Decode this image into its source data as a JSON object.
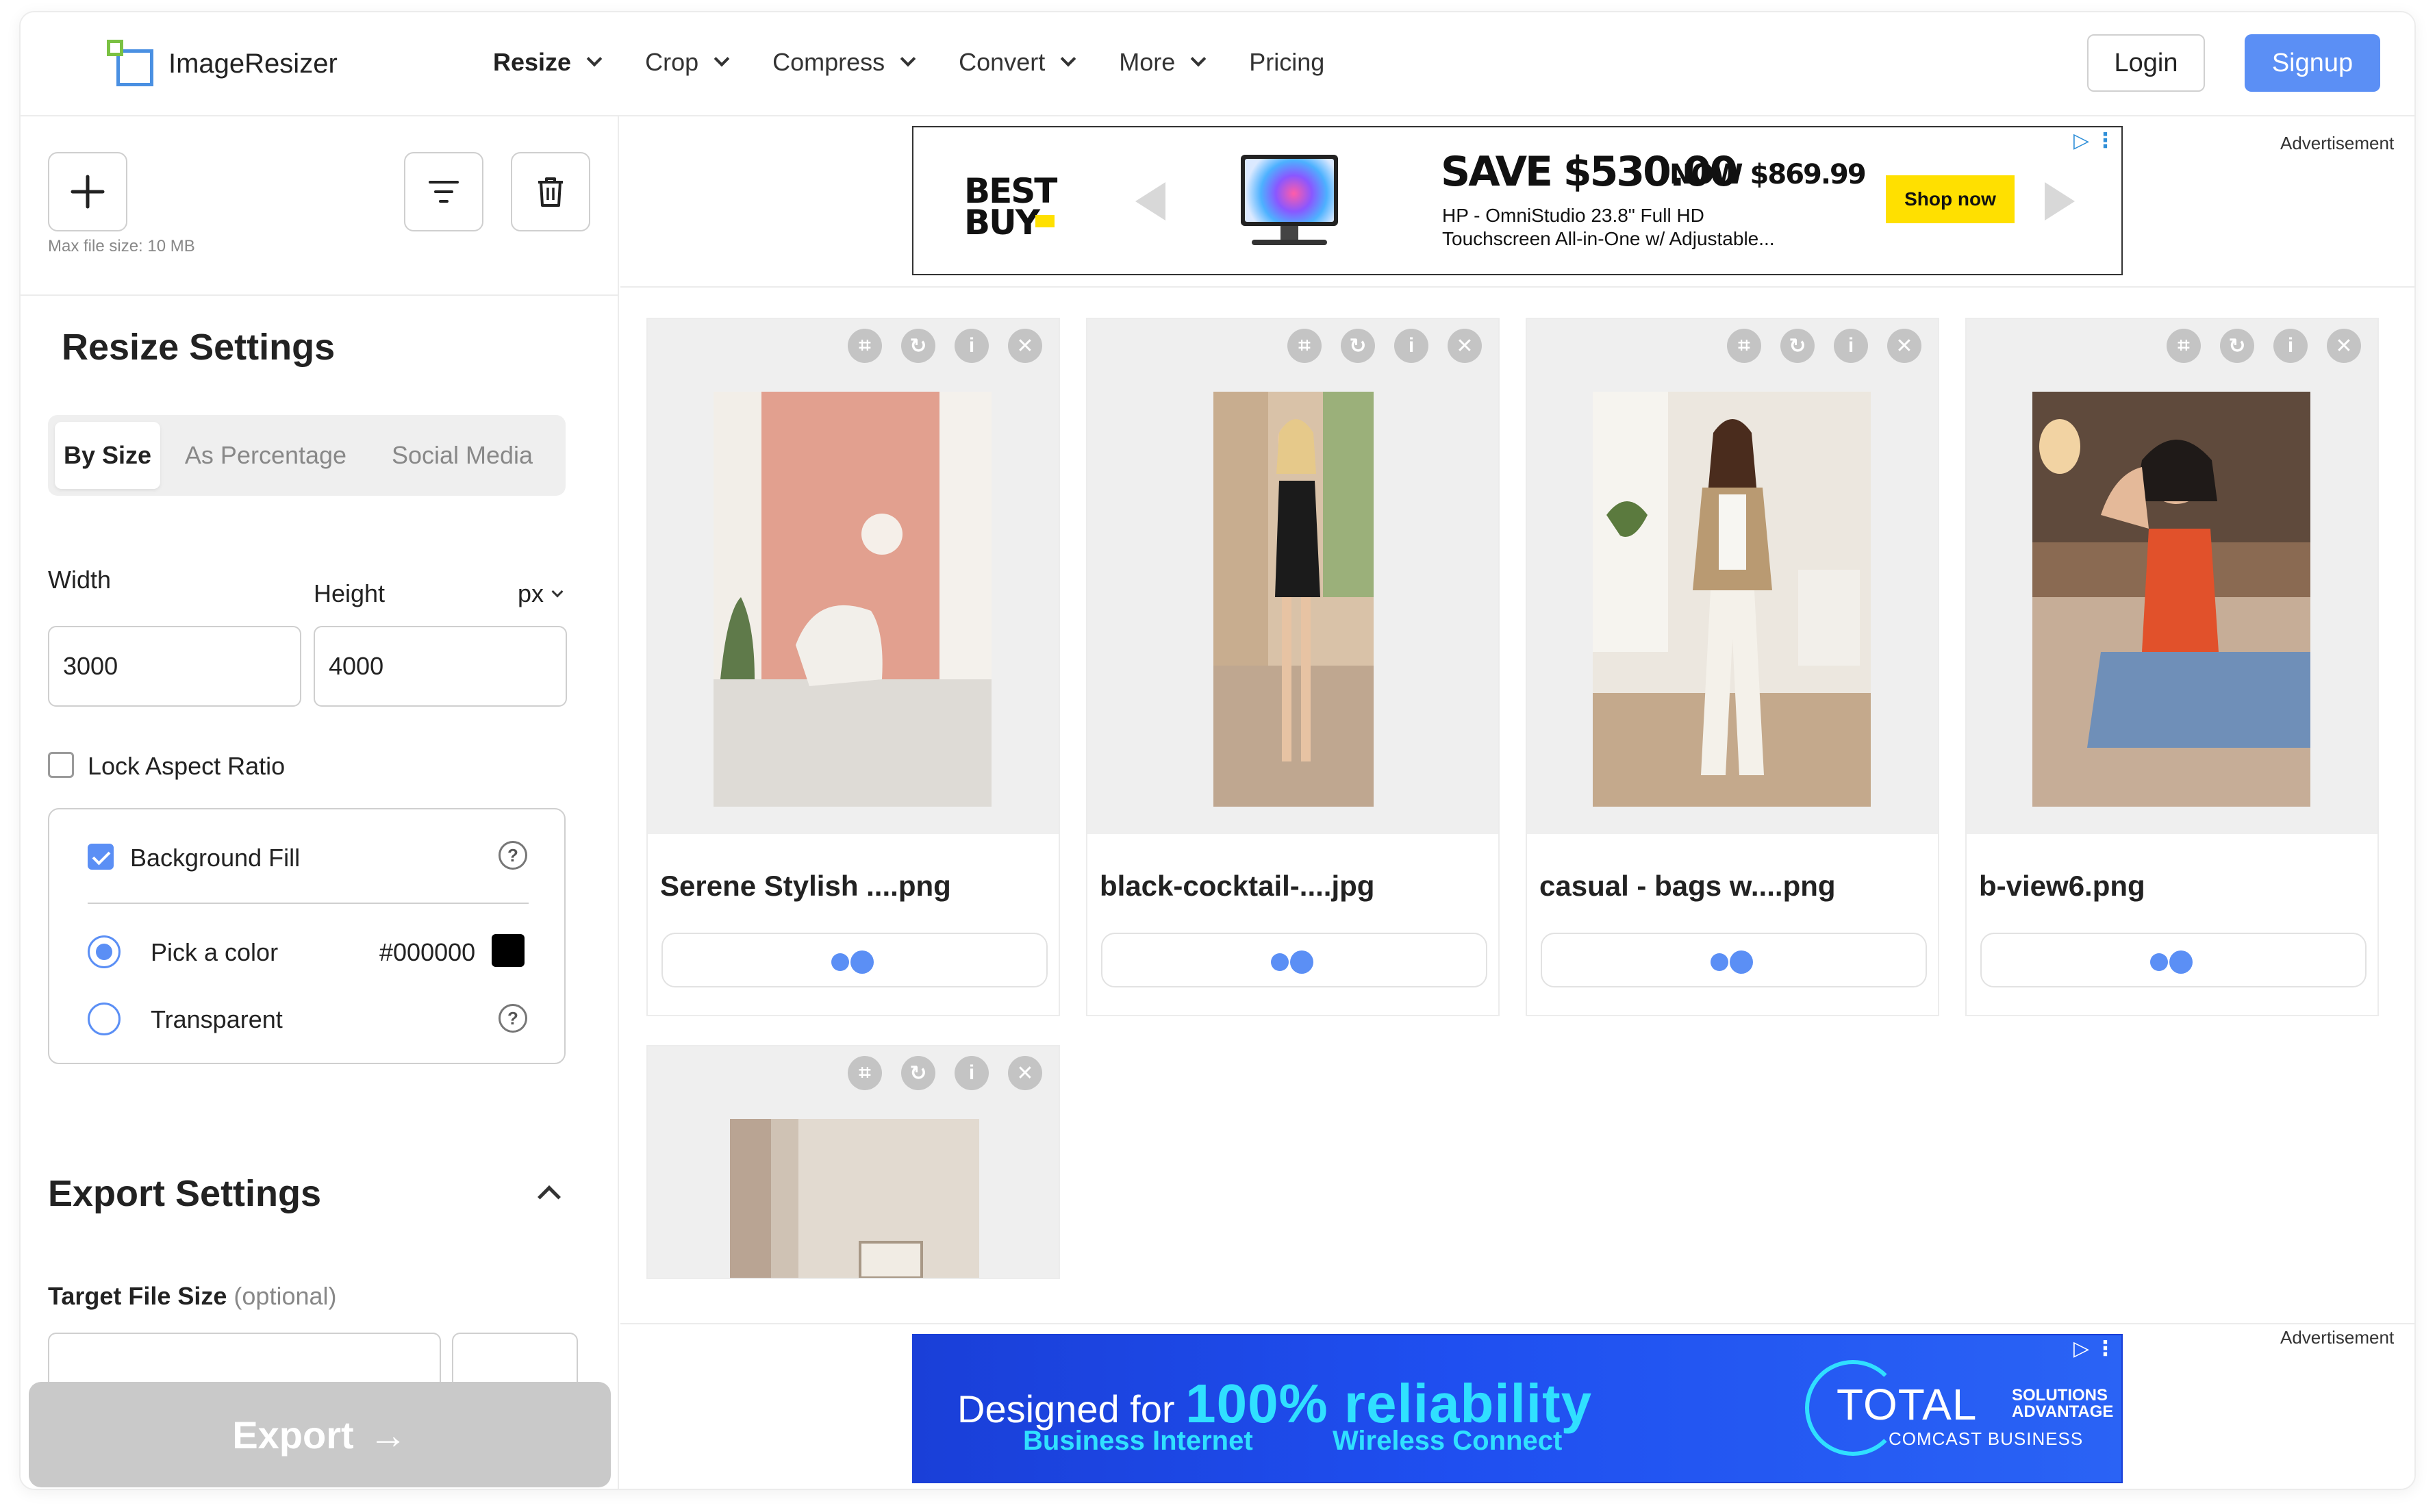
{
  "header": {
    "logo_text": "ImageResizer",
    "nav": [
      {
        "label": "Resize",
        "has_dropdown": true,
        "active": true
      },
      {
        "label": "Crop",
        "has_dropdown": true
      },
      {
        "label": "Compress",
        "has_dropdown": true
      },
      {
        "label": "Convert",
        "has_dropdown": true
      },
      {
        "label": "More",
        "has_dropdown": true
      },
      {
        "label": "Pricing",
        "has_dropdown": false
      }
    ],
    "login_label": "Login",
    "signup_label": "Signup",
    "accent": "#5b8ff5"
  },
  "toolbar": {
    "add_icon": "plus-icon",
    "filter_icon": "filter-icon",
    "delete_icon": "trash-icon",
    "max_file_size": "Max file size: 10 MB"
  },
  "resize_settings": {
    "title": "Resize Settings",
    "tabs": [
      "By Size",
      "As Percentage",
      "Social Media"
    ],
    "active_tab": "By Size",
    "width_label": "Width",
    "height_label": "Height",
    "unit": "px",
    "width_value": "3000",
    "height_value": "4000",
    "lock_aspect_label": "Lock Aspect Ratio",
    "lock_aspect_checked": false,
    "background_fill_label": "Background Fill",
    "background_fill_checked": true,
    "pick_color_label": "Pick a color",
    "color_value": "#000000",
    "transparent_label": "Transparent",
    "selected_fill": "Pick a color"
  },
  "export_settings": {
    "title": "Export Settings",
    "target_file_size_label": "Target File Size",
    "optional_label": "(optional)",
    "export_label": "Export",
    "export_arrow": "→"
  },
  "ads": {
    "label": "Advertisement",
    "top": {
      "brand_line1": "BEST",
      "brand_line2": "BUY",
      "save_text": "SAVE $530.00",
      "now_text": "NOW $869.99",
      "desc_line1": "HP - OmniStudio 23.8\" Full HD",
      "desc_line2": "Touchscreen All-in-One w/ Adjustable...",
      "cta": "Shop now"
    },
    "bottom": {
      "line1_prefix": "Designed for ",
      "line1_highlight": "100% reliability",
      "line2_left": "Business Internet",
      "line2_right": "Wireless Connect",
      "brand_total": "TOTAL",
      "brand_sol1": "SOLUTIONS",
      "brand_sol2": "ADVANTAGE",
      "brand_comcast": "COMCAST BUSINESS"
    }
  },
  "images": [
    {
      "name": "Serene Stylish ....png",
      "status": "processing"
    },
    {
      "name": "black-cocktail-....jpg",
      "status": "processing"
    },
    {
      "name": "casual - bags w....png",
      "status": "processing"
    },
    {
      "name": "b-view6.png",
      "status": "processing"
    },
    {
      "name": "",
      "status": "loading"
    }
  ],
  "card_controls": [
    "crop-icon",
    "rotate-icon",
    "info-icon",
    "close-icon"
  ]
}
